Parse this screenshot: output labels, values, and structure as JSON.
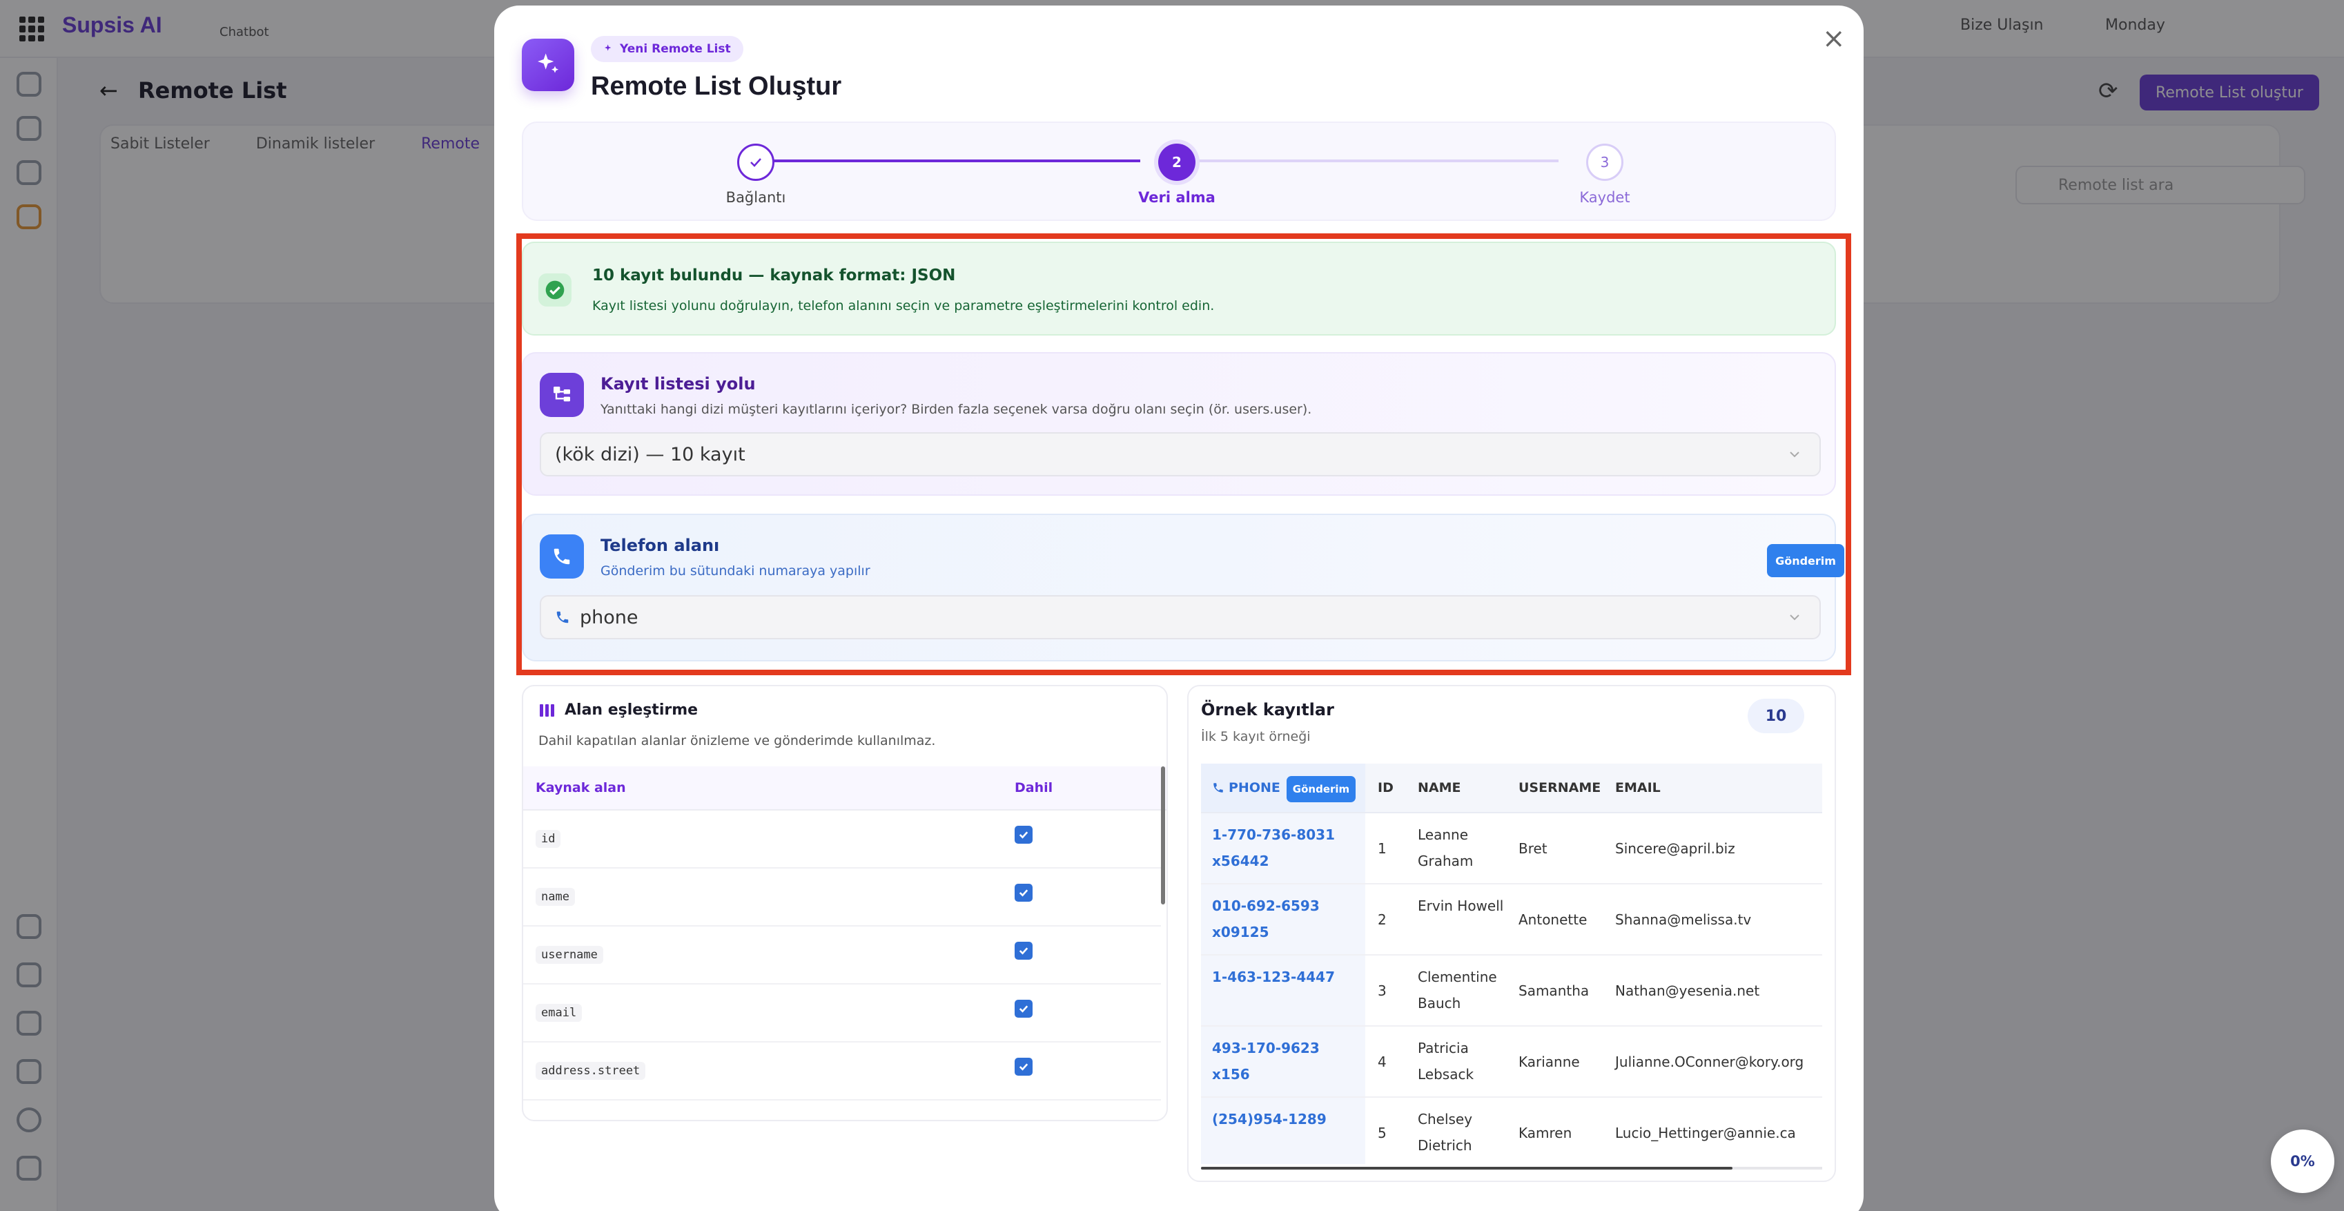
{
  "background": {
    "brand": "Supsis AI",
    "chatbot_label": "Chatbot",
    "page_title": "Remote List",
    "tabs": [
      "Sabit Listeler",
      "Dinamik listeler",
      "Remote"
    ],
    "create_button": "Remote List oluştur",
    "search_placeholder": "Remote list ara",
    "top_right": [
      "Bize Ulaşın",
      "Monday"
    ]
  },
  "modal": {
    "badge": "Yeni Remote List",
    "title": "Remote List Oluştur",
    "close_icon": "×"
  },
  "stepper": {
    "steps": [
      {
        "number": "1",
        "label": "Bağlantı",
        "state": "done"
      },
      {
        "number": "2",
        "label": "Veri alma",
        "state": "active"
      },
      {
        "number": "3",
        "label": "Kaydet",
        "state": "pending"
      }
    ]
  },
  "alert": {
    "title": "10 kayıt bulundu — kaynak format: JSON",
    "description": "Kayıt listesi yolunu doğrulayın, telefon alanını seçin ve parametre eşleştirmelerini kontrol edin."
  },
  "record_path": {
    "title": "Kayıt listesi yolu",
    "description": "Yanıttaki hangi dizi müşteri kayıtlarını içeriyor? Birden fazla seçenek varsa doğru olanı seçin (ör. users.user).",
    "selected": "(kök dizi) — 10 kayıt"
  },
  "phone_field": {
    "title": "Telefon alanı",
    "description": "Gönderim bu sütundaki numaraya yapılır",
    "badge": "Gönderim",
    "selected": "phone"
  },
  "mapping": {
    "title": "Alan eşleştirme",
    "description": "Dahil kapatılan alanlar önizleme ve gönderimde kullanılmaz.",
    "col_source": "Kaynak alan",
    "col_include": "Dahil",
    "rows": [
      {
        "field": "id",
        "included": true
      },
      {
        "field": "name",
        "included": true
      },
      {
        "field": "username",
        "included": true
      },
      {
        "field": "email",
        "included": true
      },
      {
        "field": "address.street",
        "included": true
      }
    ]
  },
  "samples": {
    "title": "Örnek kayıtlar",
    "subtitle": "İlk 5 kayıt örneği",
    "count": "10",
    "headers": {
      "phone": "PHONE",
      "gonderim": "Gönderim",
      "id": "ID",
      "name": "NAME",
      "username": "USERNAME",
      "email": "EMAIL"
    },
    "rows": [
      {
        "phone": "1-770-736-8031 x56442",
        "id": "1",
        "name": "Leanne Graham",
        "username": "Bret",
        "email": "Sincere@april.biz"
      },
      {
        "phone": "010-692-6593 x09125",
        "id": "2",
        "name": "Ervin Howell",
        "username": "Antonette",
        "email": "Shanna@melissa.tv"
      },
      {
        "phone": "1-463-123-4447",
        "id": "3",
        "name": "Clementine Bauch",
        "username": "Samantha",
        "email": "Nathan@yesenia.net"
      },
      {
        "phone": "493-170-9623 x156",
        "id": "4",
        "name": "Patricia Lebsack",
        "username": "Karianne",
        "email": "Julianne.OConner@kory.org"
      },
      {
        "phone": "(254)954-1289",
        "id": "5",
        "name": "Chelsey Dietrich",
        "username": "Kamren",
        "email": "Lucio_Hettinger@annie.ca"
      }
    ]
  },
  "progress": "0%",
  "colors": {
    "accent": "#6d28d9",
    "phone_blue": "#2f80ed",
    "highlight": "#e33a1e",
    "success": "#166534"
  }
}
